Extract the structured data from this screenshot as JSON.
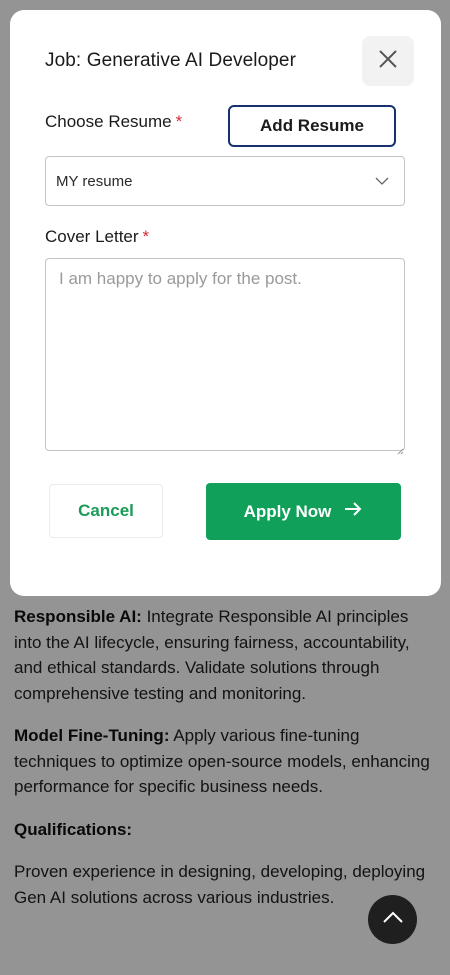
{
  "background": {
    "paragraphs": [
      {
        "heading": "Responsible AI:",
        "text": " Integrate Responsible AI principles into the AI lifecycle, ensuring fairness, accountability, and ethical standards. Validate solutions through comprehensive testing and monitoring."
      },
      {
        "heading": "Model Fine-Tuning:",
        "text": " Apply various fine-tuning techniques to optimize open-source models, enhancing performance for specific business needs."
      }
    ],
    "qualifications_heading": "Qualifications:",
    "qualifications_text": "Proven experience in designing, developing, deploying Gen AI solutions across various industries."
  },
  "modal": {
    "title": "Job: Generative AI Developer",
    "resume_label": "Choose Resume",
    "required_mark": "*",
    "add_resume_label": "Add Resume",
    "resume_selected": "MY resume",
    "cover_letter_label": "Cover Letter",
    "cover_letter_placeholder": "I am happy to apply for the post.",
    "cancel_label": "Cancel",
    "apply_label": "Apply Now"
  },
  "colors": {
    "accent_green": "#11a05a",
    "required_red": "#d62b3a",
    "add_resume_border": "#17306e"
  },
  "icons": {
    "close": "close-icon",
    "dropdown": "chevron-down-icon",
    "apply_arrow": "arrow-right-icon",
    "scroll_top": "chevron-up-icon"
  }
}
